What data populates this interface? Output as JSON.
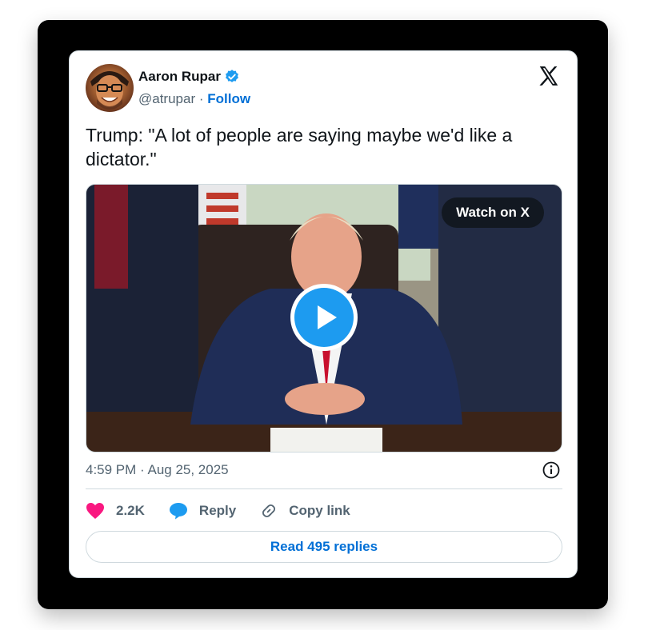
{
  "author": {
    "name": "Aaron Rupar",
    "handle": "@atrupar",
    "separator": "·",
    "follow_label": "Follow"
  },
  "tweet": {
    "text": "Trump: \"A lot of people are saying maybe we'd like a dictator.\"",
    "watch_label": "Watch on X",
    "timestamp": "4:59 PM · Aug 25, 2025"
  },
  "actions": {
    "likes": "2.2K",
    "reply_label": "Reply",
    "copy_label": "Copy link",
    "read_replies_label": "Read 495 replies"
  },
  "icons": {
    "verified": "verified-badge-icon",
    "brand": "x-logo-icon",
    "info": "info-icon",
    "like": "heart-icon",
    "reply": "speech-bubble-icon",
    "copy": "link-icon",
    "play": "play-icon"
  },
  "colors": {
    "accent": "#1d9bf0",
    "link": "#006fd6",
    "heart": "#f91880",
    "text": "#0f1419",
    "muted": "#536471"
  }
}
